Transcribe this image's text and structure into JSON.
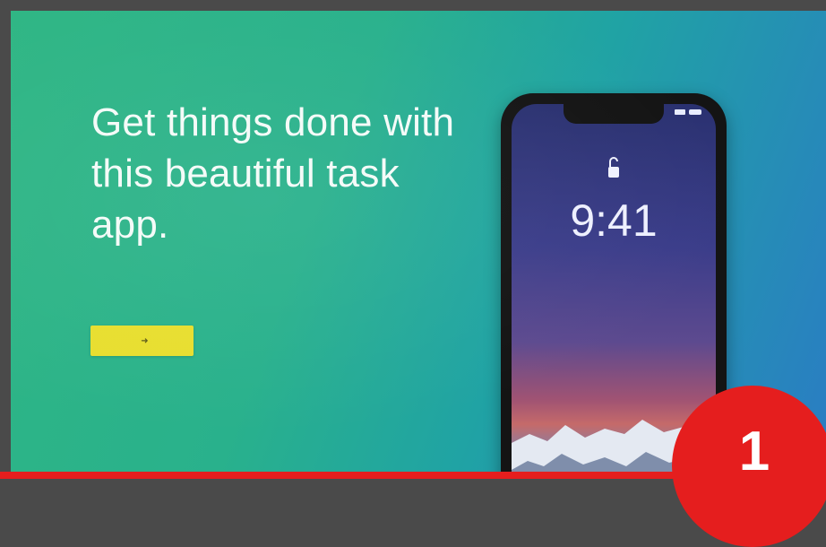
{
  "hero": {
    "headline": "Get things done with this beautiful task app.",
    "subtext": "",
    "cta_label": "",
    "cta_icon": "arrow-right-icon",
    "background_colors": [
      "#2fb684",
      "#20a3a4",
      "#2a7cc4"
    ]
  },
  "phone": {
    "time": "9:41",
    "date": "",
    "lock_icon": "unlocked-padlock-icon"
  },
  "badge": {
    "number": "1",
    "color": "#e51e1e"
  },
  "cta_color": "#e8de2e"
}
